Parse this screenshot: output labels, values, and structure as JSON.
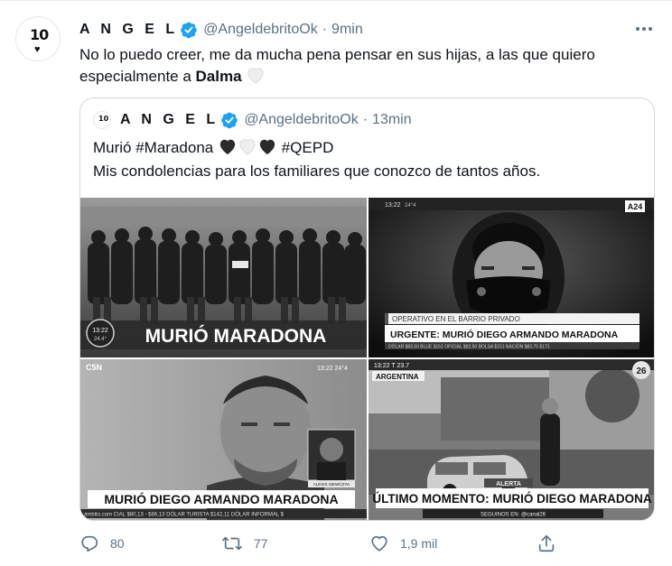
{
  "tweet": {
    "author": {
      "name": "A N G E L",
      "handle": "@AngeldebritoOk",
      "avatar_text": "10",
      "avatar_heart": "♥"
    },
    "separator": "·",
    "time": "9min",
    "text_before": "No lo puedo creer, me da mucha pena pensar en sus hijas, a las que quiero especialmente a ",
    "text_bold": "Dalma",
    "more_icon": "more-horizontal-icon"
  },
  "quoted": {
    "author": {
      "name": "A N G E L",
      "handle": "@AngeldebritoOk",
      "avatar_text": "10"
    },
    "separator": "·",
    "time": "13min",
    "line1": "Murió #Maradona",
    "hashtag": "#QEPD",
    "line2": "Mis condolencias para los familiares que conozco de tantos años.",
    "images": {
      "tile1": {
        "banner": "MURIÓ MARADONA",
        "clock_time": "13:22",
        "clock_temp": "24.4°"
      },
      "tile2": {
        "top_left": "13:22",
        "top_temp": "24°4",
        "channel": "A24",
        "subtitle": "OPERATIVO EN EL BARRIO PRIVADO",
        "banner": "URGENTE: MURIÓ DIEGO ARMANDO MARADONA",
        "ticker": "DÓLAR  $83,50  BLUE $151  OFICIAL $82,50  BOLSA $151  NACIÓN $83,75  $171"
      },
      "tile3": {
        "channel": "C5N",
        "top_right": "13:22   24°4",
        "banner": "MURIÓ DIEGO ARMANDO MARADONA",
        "ticker": "ámbito.com  CIAL $80,13 - $86,13   DÓLAR TURISTA $142,11   DÓLAR INFORMAL $",
        "inset_label": "ALEXIS SIEWCZYK"
      },
      "tile4": {
        "top_left": "13:22  T 23.7",
        "location": "ARGENTINA",
        "channel": "26",
        "tag": "ALERTA",
        "banner": "ÚLTIMO MOMENTO: MURIÓ DIEGO MARADONA",
        "footer": "SEGUINOS EN:  @canal26"
      }
    }
  },
  "actions": {
    "reply_count": "80",
    "retweet_count": "77",
    "like_count": "1,9 mil"
  },
  "colors": {
    "secondary_text": "#5b7083",
    "verified_blue": "#1da1f2",
    "border": "#cfd9de"
  }
}
